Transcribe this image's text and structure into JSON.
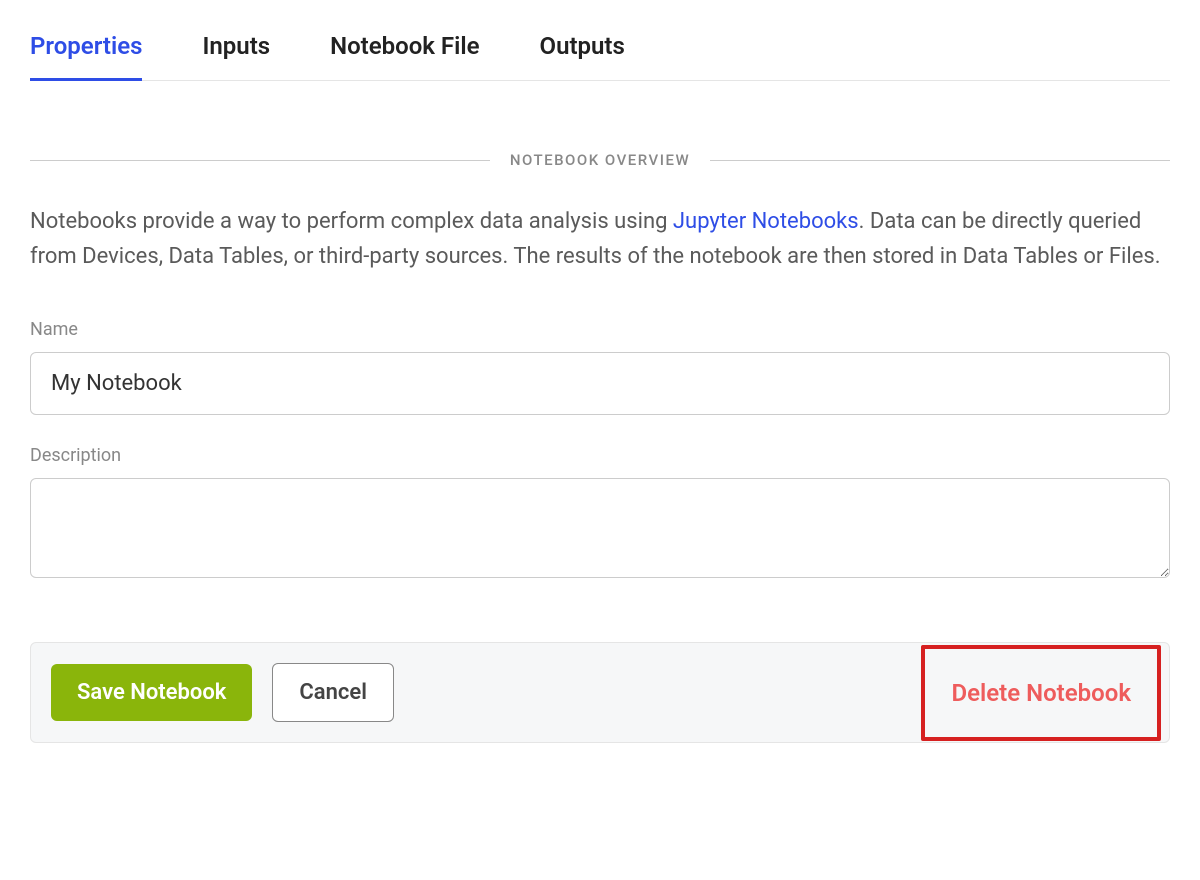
{
  "tabs": {
    "properties": "Properties",
    "inputs": "Inputs",
    "notebook_file": "Notebook File",
    "outputs": "Outputs",
    "active": "properties"
  },
  "section": {
    "title": "NOTEBOOK OVERVIEW"
  },
  "overview": {
    "part1": "Notebooks provide a way to perform complex data analysis using ",
    "link_text": "Jupyter Notebooks",
    "part2": ". Data can be directly queried from Devices, Data Tables, or third-party sources. The results of the notebook are then stored in Data Tables or Files."
  },
  "fields": {
    "name_label": "Name",
    "name_value": "My Notebook",
    "description_label": "Description",
    "description_value": ""
  },
  "actions": {
    "save": "Save Notebook",
    "cancel": "Cancel",
    "delete": "Delete Notebook"
  },
  "colors": {
    "accent": "#2e4de6",
    "save_bg": "#8ab50b",
    "delete_text": "#ee5c5c",
    "highlight_border": "#d62020"
  }
}
